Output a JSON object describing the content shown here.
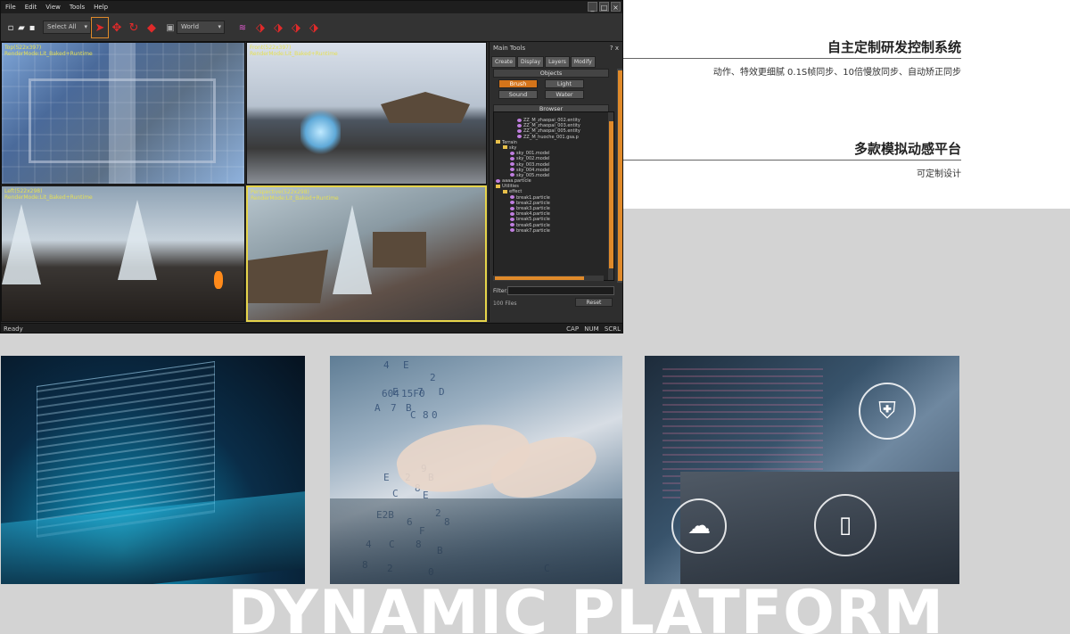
{
  "editor": {
    "menu": [
      "File",
      "Edit",
      "View",
      "Tools",
      "Help"
    ],
    "toolbar": {
      "select_mode": "Select All",
      "coord_space": "World"
    },
    "viewports": [
      {
        "label": "Top(522x397)\nRenderMode:Lit_Baked+Runtime"
      },
      {
        "label": "Front(522x397)\nRenderMode:Lit_Baked+Runtime"
      },
      {
        "label": "Left(522x298)\nRenderMode:Lit_Baked+Runtime"
      },
      {
        "label": "Perspective(522x298)\nRenderMode:Lit_Baked+Runtime"
      }
    ],
    "tools_panel": {
      "title": "Main Tools",
      "close": "? x",
      "tabs": [
        "Create",
        "Display",
        "Layers",
        "Modify"
      ],
      "objects_header": "Objects",
      "buttons": [
        "Brush",
        "Light",
        "Sound",
        "Water"
      ],
      "browser_header": "Browser",
      "tree": [
        {
          "indent": 3,
          "icon": "file",
          "text": "ZZ_M_zhaopai_002.entity"
        },
        {
          "indent": 3,
          "icon": "file",
          "text": "ZZ_M_zhaopai_003.entity"
        },
        {
          "indent": 3,
          "icon": "file",
          "text": "ZZ_M_zhaopai_005.entity"
        },
        {
          "indent": 3,
          "icon": "file",
          "text": "ZZ_M_huoche_001.gsa.p"
        },
        {
          "indent": 0,
          "icon": "folder",
          "text": "Terrain"
        },
        {
          "indent": 1,
          "icon": "folder",
          "text": "sky"
        },
        {
          "indent": 2,
          "icon": "file",
          "text": "sky_001.model"
        },
        {
          "indent": 2,
          "icon": "file",
          "text": "sky_002.model"
        },
        {
          "indent": 2,
          "icon": "file",
          "text": "sky_003.model"
        },
        {
          "indent": 2,
          "icon": "file",
          "text": "sky_004.model"
        },
        {
          "indent": 2,
          "icon": "file",
          "text": "sky_005.model"
        },
        {
          "indent": 0,
          "icon": "file",
          "text": "aaaa.particle"
        },
        {
          "indent": 0,
          "icon": "folder",
          "text": "Utilities"
        },
        {
          "indent": 1,
          "icon": "folder",
          "text": "effect"
        },
        {
          "indent": 2,
          "icon": "file",
          "text": "break1.particle"
        },
        {
          "indent": 2,
          "icon": "file",
          "text": "break2.particle"
        },
        {
          "indent": 2,
          "icon": "file",
          "text": "break3.particle"
        },
        {
          "indent": 2,
          "icon": "file",
          "text": "break4.particle"
        },
        {
          "indent": 2,
          "icon": "file",
          "text": "break5.particle"
        },
        {
          "indent": 2,
          "icon": "file",
          "text": "break6.particle"
        },
        {
          "indent": 2,
          "icon": "file",
          "text": "break7.particle"
        }
      ],
      "filter_label": "Filter:",
      "files_count": "100 Files",
      "reset": "Reset"
    },
    "status": {
      "left": "Ready",
      "right": "CAP  NUM  SCRL"
    }
  },
  "sections": [
    {
      "heading": "自主定制研发控制系统",
      "sub": "动作、特效更细腻 0.1S帧同步、10倍慢放同步、自动矫正同步"
    },
    {
      "heading": "多款模拟动感平台",
      "sub": "可定制设计"
    }
  ],
  "photo2_glyphs": [
    "4",
    "E",
    "2",
    "F",
    "7",
    "D",
    "604",
    "15F",
    "0",
    "A",
    "7",
    "B",
    "8",
    "C",
    "0",
    "9",
    "E",
    "2",
    "B",
    "8",
    "C",
    "E",
    "2",
    "E2B",
    "6",
    "8",
    "F",
    "4",
    "C",
    "8",
    "B",
    "8",
    "2",
    "0",
    "C"
  ],
  "banner": "DYNAMIC PLATFORM"
}
